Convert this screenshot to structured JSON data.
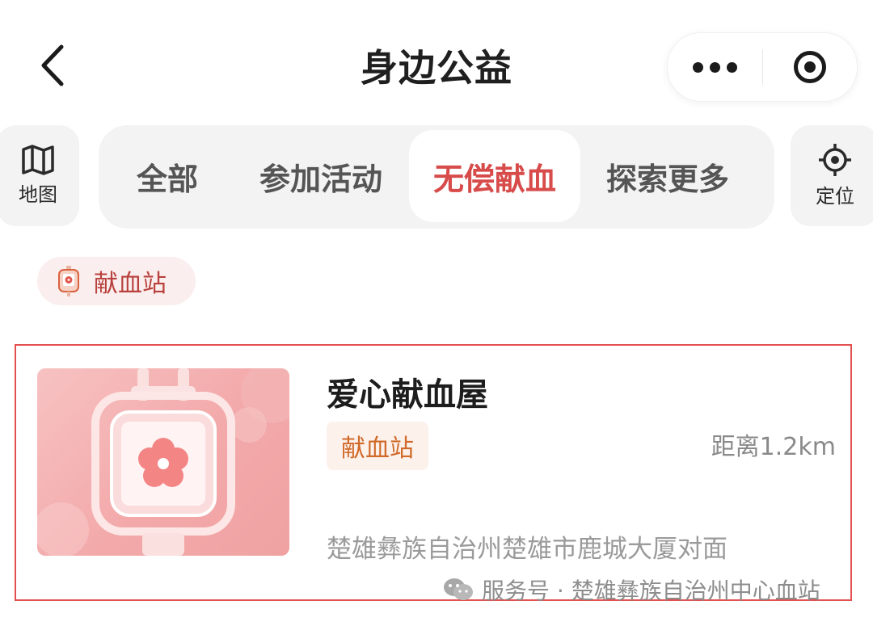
{
  "navbar": {
    "title": "身边公益",
    "back_icon": "chevron-left-icon",
    "more_icon": "more-dots-icon",
    "close_icon": "target-icon"
  },
  "side": {
    "map_label": "地图",
    "map_icon": "map-icon",
    "locate_label": "定位",
    "locate_icon": "crosshair-icon"
  },
  "tabs": [
    {
      "label": "全部"
    },
    {
      "label": "参加活动"
    },
    {
      "label": "无偿献血",
      "active": true
    },
    {
      "label": "探索更多"
    }
  ],
  "filter_chip": {
    "label": "献血站",
    "icon": "blood-bag-icon"
  },
  "result": {
    "title": "爱心献血屋",
    "tag": "献血站",
    "distance": "距离1.2km",
    "address": "楚雄彝族自治州楚雄市鹿城大厦对面",
    "image_icon": "blood-bag-illustration"
  },
  "watermark": {
    "text": "服务号 · 楚雄彝族自治州中心血站",
    "icon": "wechat-icon"
  },
  "colors": {
    "accent": "#d84b4b",
    "tag_text": "#d06a2a",
    "card_border": "#e25050"
  }
}
